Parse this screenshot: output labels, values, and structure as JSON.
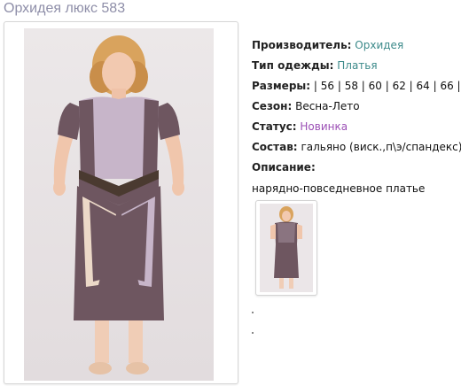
{
  "product": {
    "title": "Орхидея люкс 583"
  },
  "details": {
    "manufacturer_label": "Производитель:",
    "manufacturer_value": "Орхидея",
    "clothing_type_label": "Тип одежды:",
    "clothing_type_value": "Платья",
    "sizes_label": "Размеры:",
    "sizes_value": "| 56 | 58 | 60 | 62 | 64 | 66 |",
    "season_label": "Сезон:",
    "season_value": "Весна-Лето",
    "status_label": "Статус:",
    "status_value": "Новинка",
    "composition_label": "Состав:",
    "composition_value": "гальяно (виск.,п\\э/спандекс)",
    "description_label": "Описание:",
    "description_value": "нарядно-повседневное платье"
  },
  "colors": {
    "title": "#8e8ea8",
    "link_teal": "#3c8a8a",
    "link_purple": "#9b4fb5",
    "dress_main": "#6e5660",
    "dress_light": "#c7b5c9",
    "dress_dark": "#4a3a30",
    "dress_cream": "#ecd9c8"
  },
  "images": {
    "main_icon": "dress-photo",
    "thumbnail_icon": "dress-thumbnail"
  }
}
